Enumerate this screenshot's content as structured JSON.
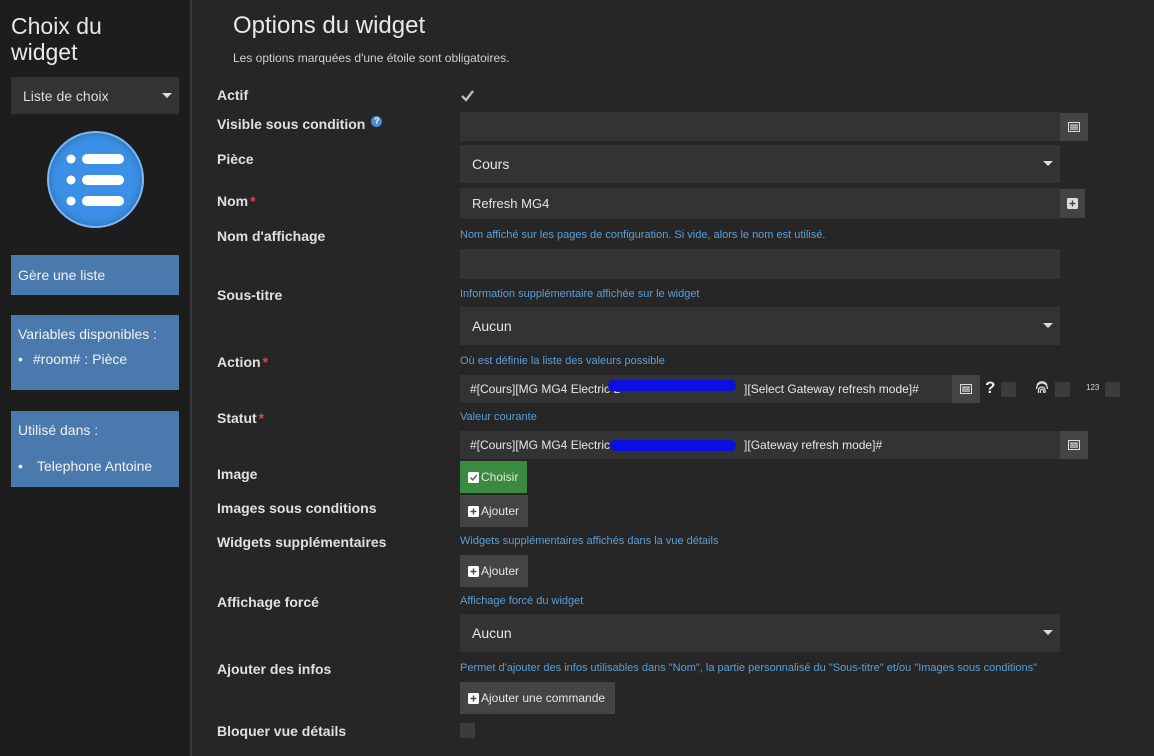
{
  "sidebar": {
    "title_line1": "Choix du",
    "title_line2": "widget",
    "widget_type": "Liste de choix",
    "icon_name": "list-icon",
    "panel_description": "Gère une liste",
    "panel_variables_title": "Variables disponibles :",
    "variables": [
      "#room# : Pièce"
    ],
    "panel_used_title": "Utilisé dans :",
    "used_in": [
      "Telephone Antoine"
    ]
  },
  "header": {
    "title": "Options du widget",
    "subtitle": "Les options marquées d'une étoile sont obligatoires."
  },
  "form": {
    "actif": {
      "label": "Actif",
      "checked": true
    },
    "visible": {
      "label": "Visible sous condition",
      "value": ""
    },
    "piece": {
      "label": "Pièce",
      "value": "Cours"
    },
    "nom": {
      "label": "Nom",
      "required_mark": "*",
      "value": "Refresh MG4"
    },
    "nom_affichage": {
      "label": "Nom d'affichage",
      "help": "Nom affiché sur les pages de configuration. Si vide, alors le nom est utilisé.",
      "value": ""
    },
    "sous_titre": {
      "label": "Sous-titre",
      "help": "Information supplémentaire affichée sur le widget",
      "value": "Aucun"
    },
    "action": {
      "label": "Action",
      "required_mark": "*",
      "help": "Où est définie la liste des valeurs possible",
      "value_start": "#[Cours][MG MG4 Electric L",
      "value_end": "][Select Gateway refresh mode]#",
      "question_mark": "?",
      "number_badge": "123"
    },
    "statut": {
      "label": "Statut",
      "required_mark": "*",
      "help": "Valeur courante",
      "value_start": "#[Cours][MG MG4 Electric L",
      "value_end": "][Gateway refresh mode]#"
    },
    "image": {
      "label": "Image",
      "button": "Choisir"
    },
    "images_conditions": {
      "label": "Images sous conditions",
      "button": "Ajouter"
    },
    "widgets_supp": {
      "label": "Widgets supplémentaires",
      "help": "Widgets supplémentaires affichés dans la vue détails",
      "button": "Ajouter"
    },
    "affichage_force": {
      "label": "Affichage forcé",
      "help": "Affichage forcé du widget",
      "value": "Aucun"
    },
    "ajouter_infos": {
      "label": "Ajouter des infos",
      "help": "Permet d'ajouter des infos utilisables dans \"Nom\", la partie personnalisé du \"Sous-titre\" et/ou \"Images sous conditions\"",
      "button": "Ajouter une commande"
    },
    "bloquer": {
      "label": "Bloquer vue détails",
      "checked": false
    }
  },
  "colors": {
    "accent_blue": "#4a79ad",
    "help_text": "#5a9fd8",
    "required": "#e04545",
    "success": "#3a8a3f"
  }
}
